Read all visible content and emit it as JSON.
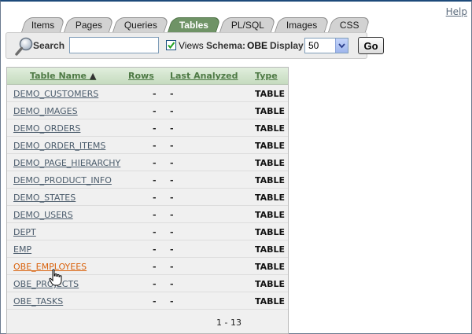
{
  "header": {
    "help_link": "Help"
  },
  "tabs": [
    {
      "label": "Items",
      "active": false
    },
    {
      "label": "Pages",
      "active": false
    },
    {
      "label": "Queries",
      "active": false
    },
    {
      "label": "Tables",
      "active": true
    },
    {
      "label": "PL/SQL",
      "active": false
    },
    {
      "label": "Images",
      "active": false
    },
    {
      "label": "CSS",
      "active": false
    }
  ],
  "search": {
    "search_label": "Search",
    "search_value": "",
    "views_label": "Views",
    "views_checked": true,
    "schema_label": "Schema:",
    "schema_value": "OBE",
    "display_label": "Display",
    "display_value": "50",
    "go_label": "Go"
  },
  "table": {
    "columns": [
      "Table Name",
      "Rows",
      "Last Analyzed",
      "Type"
    ],
    "sort_indicator": "▲",
    "rows": [
      {
        "name": "DEMO_CUSTOMERS",
        "rows": "-",
        "last_analyzed": "-",
        "type": "TABLE"
      },
      {
        "name": "DEMO_IMAGES",
        "rows": "-",
        "last_analyzed": "-",
        "type": "TABLE"
      },
      {
        "name": "DEMO_ORDERS",
        "rows": "-",
        "last_analyzed": "-",
        "type": "TABLE"
      },
      {
        "name": "DEMO_ORDER_ITEMS",
        "rows": "-",
        "last_analyzed": "-",
        "type": "TABLE"
      },
      {
        "name": "DEMO_PAGE_HIERARCHY",
        "rows": "-",
        "last_analyzed": "-",
        "type": "TABLE"
      },
      {
        "name": "DEMO_PRODUCT_INFO",
        "rows": "-",
        "last_analyzed": "-",
        "type": "TABLE"
      },
      {
        "name": "DEMO_STATES",
        "rows": "-",
        "last_analyzed": "-",
        "type": "TABLE"
      },
      {
        "name": "DEMO_USERS",
        "rows": "-",
        "last_analyzed": "-",
        "type": "TABLE"
      },
      {
        "name": "DEPT",
        "rows": "-",
        "last_analyzed": "-",
        "type": "TABLE"
      },
      {
        "name": "EMP",
        "rows": "-",
        "last_analyzed": "-",
        "type": "TABLE"
      },
      {
        "name": "OBE_EMPLOYEES",
        "rows": "-",
        "last_analyzed": "-",
        "type": "TABLE"
      },
      {
        "name": "OBE_PROJECTS",
        "rows": "-",
        "last_analyzed": "-",
        "type": "TABLE"
      },
      {
        "name": "OBE_TASKS",
        "rows": "-",
        "last_analyzed": "-",
        "type": "TABLE"
      }
    ],
    "pagination": "1 - 13"
  },
  "colors": {
    "active_tab": "#6f9366",
    "header_link": "#4e7a45",
    "row_link": "#4b5c6c",
    "hover_link": "#d9620c"
  },
  "icons": {
    "search": "magnifier-icon",
    "cursor": "hand-pointer-icon"
  }
}
